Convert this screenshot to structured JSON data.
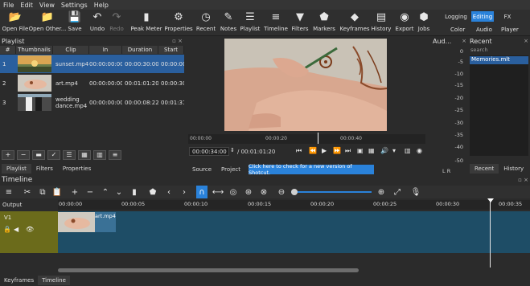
{
  "menu": [
    "File",
    "Edit",
    "View",
    "Settings",
    "Help"
  ],
  "toolbar": [
    {
      "label": "Open File",
      "icon": "folder-open-icon",
      "glyph": "📂"
    },
    {
      "label": "Open Other...",
      "icon": "open-other-icon",
      "glyph": "📁"
    },
    {
      "label": "Save",
      "icon": "save-icon",
      "glyph": "💾"
    },
    {
      "label": "Undo",
      "icon": "undo-icon",
      "glyph": "↶"
    },
    {
      "label": "Redo",
      "icon": "redo-icon",
      "glyph": "↷"
    },
    {
      "label": "Peak Meter",
      "icon": "peak-meter-icon",
      "glyph": "▮"
    },
    {
      "label": "Properties",
      "icon": "properties-icon",
      "glyph": "⚙"
    },
    {
      "label": "Recent",
      "icon": "recent-clock-icon",
      "glyph": "◷"
    },
    {
      "label": "Notes",
      "icon": "notes-icon",
      "glyph": "✎"
    },
    {
      "label": "Playlist",
      "icon": "playlist-icon",
      "glyph": "☰"
    },
    {
      "label": "Timeline",
      "icon": "timeline-icon",
      "glyph": "≡"
    },
    {
      "label": "Filters",
      "icon": "filter-funnel-icon",
      "glyph": "▼"
    },
    {
      "label": "Markers",
      "icon": "markers-icon",
      "glyph": "⬟"
    },
    {
      "label": "Keyframes",
      "icon": "keyframes-icon",
      "glyph": "◆"
    },
    {
      "label": "History",
      "icon": "history-icon",
      "glyph": "▤"
    },
    {
      "label": "Export",
      "icon": "export-disc-icon",
      "glyph": "◉"
    },
    {
      "label": "Jobs",
      "icon": "jobs-icon",
      "glyph": "⬢"
    }
  ],
  "workspaces": {
    "top": [
      "Logging",
      "Editing",
      "FX"
    ],
    "bottom": [
      "Color",
      "Audio",
      "Player"
    ],
    "selected": "Editing"
  },
  "playlist": {
    "title": "Playlist",
    "columns": [
      "#",
      "Thumbnails",
      "Clip",
      "In",
      "Duration",
      "Start"
    ],
    "rows": [
      {
        "num": "1",
        "clip": "sunset.mp4",
        "in": "00:00:00:00",
        "duration": "00:00:30:00",
        "start": "00:00:00",
        "selected": true
      },
      {
        "num": "2",
        "clip": "art.mp4",
        "in": "00:00:00:00",
        "duration": "00:01:01:20",
        "start": "00:00:30",
        "selected": false
      },
      {
        "num": "3",
        "clip": "wedding dance.mp4",
        "in": "00:00:00:00",
        "duration": "00:00:08:22",
        "start": "00:01:31",
        "selected": false
      }
    ],
    "tabs": [
      "Playlist",
      "Filters",
      "Properties"
    ]
  },
  "player": {
    "ruler_ticks": [
      "00:00:00",
      "00:00:20",
      "00:00:40"
    ],
    "position": "00:00:34:00",
    "duration": "/ 00:01:01:20",
    "tabs": [
      "Source",
      "Project"
    ],
    "update_text": "Click here to check for a new version of Shotcut."
  },
  "audio": {
    "title": "Aud...",
    "scale": [
      "0",
      "-5",
      "-10",
      "-15",
      "-20",
      "-25",
      "-30",
      "-35",
      "-40",
      "-50"
    ],
    "lr": "L  R"
  },
  "recent": {
    "title": "Recent",
    "search_placeholder": "search",
    "items": [
      "Memories.mlt"
    ],
    "tabs": [
      "Recent",
      "History"
    ]
  },
  "timeline": {
    "title": "Timeline",
    "output_label": "Output",
    "track": "V1",
    "clip_label": "art.mp4",
    "ruler": [
      "00:00:00",
      "00:00:05",
      "00:00:10",
      "00:00:15",
      "00:00:20",
      "00:00:25",
      "00:00:30",
      "00:00:35"
    ],
    "bottom_tabs": [
      "Keyframes",
      "Timeline"
    ]
  }
}
